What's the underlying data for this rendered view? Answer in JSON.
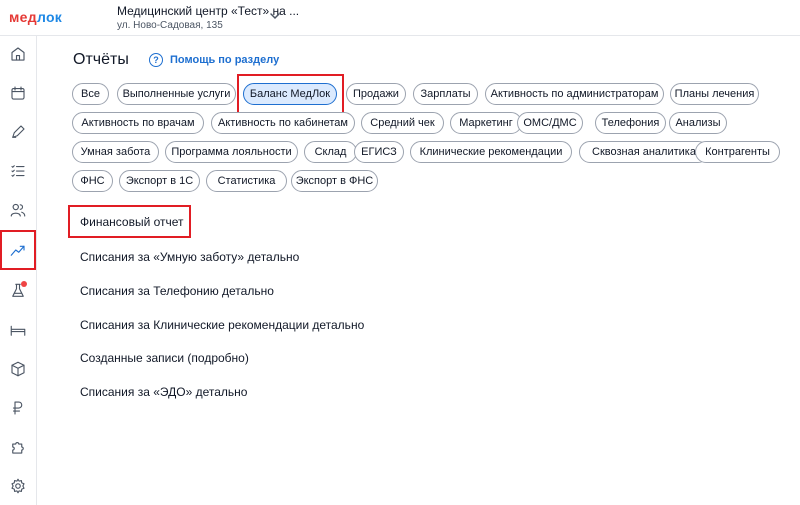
{
  "header": {
    "logo_part1": "мед",
    "logo_part2": "лок",
    "clinic_name": "Медицинский центр «Тест» на ...",
    "clinic_address": "ул. Ново-Садовая, 135"
  },
  "sidebar": {
    "items": [
      {
        "name": "home-icon"
      },
      {
        "name": "calendar-icon"
      },
      {
        "name": "pen-icon"
      },
      {
        "name": "list-icon"
      },
      {
        "name": "users-icon"
      },
      {
        "name": "chart-icon",
        "active": true
      },
      {
        "name": "flask-icon",
        "badge": true
      },
      {
        "name": "bed-icon"
      },
      {
        "name": "box-icon"
      },
      {
        "name": "ruble-icon"
      },
      {
        "name": "puzzle-icon"
      },
      {
        "name": "gear-icon"
      }
    ]
  },
  "main": {
    "title": "Отчёты",
    "help_label": "Помощь по разделу",
    "filters": [
      [
        "Все",
        "Выполненные услуги",
        "Баланс МедЛок",
        "Продажи",
        "Зарплаты",
        "Активность по администраторам",
        "Планы лечения"
      ],
      [
        "Активность по врачам",
        "Активность по кабинетам",
        "Средний чек",
        "Маркетинг",
        "ОМС/ДМС",
        "Телефония",
        "Анализы"
      ],
      [
        "Умная забота",
        "Программа лояльности",
        "Склад",
        "ЕГИСЗ",
        "Клинические рекомендации",
        "Сквозная аналитика",
        "Контрагенты"
      ],
      [
        "ФНС",
        "Экспорт в 1С",
        "Статистика",
        "Экспорт в ФНС"
      ]
    ],
    "selected_filter": "Баланс МедЛок",
    "reports": [
      "Финансовый отчет",
      "Списания за «Умную заботу» детально",
      "Списания за Телефонию детально",
      "Списания за Клинические рекомендации детально",
      "Созданные записи (подробно)",
      "Списания за «ЭДО» детально"
    ]
  },
  "colors": {
    "accent": "#1e6fd0",
    "highlight": "#e11d24",
    "logo_red": "#e53935",
    "logo_blue": "#1e88e5"
  }
}
